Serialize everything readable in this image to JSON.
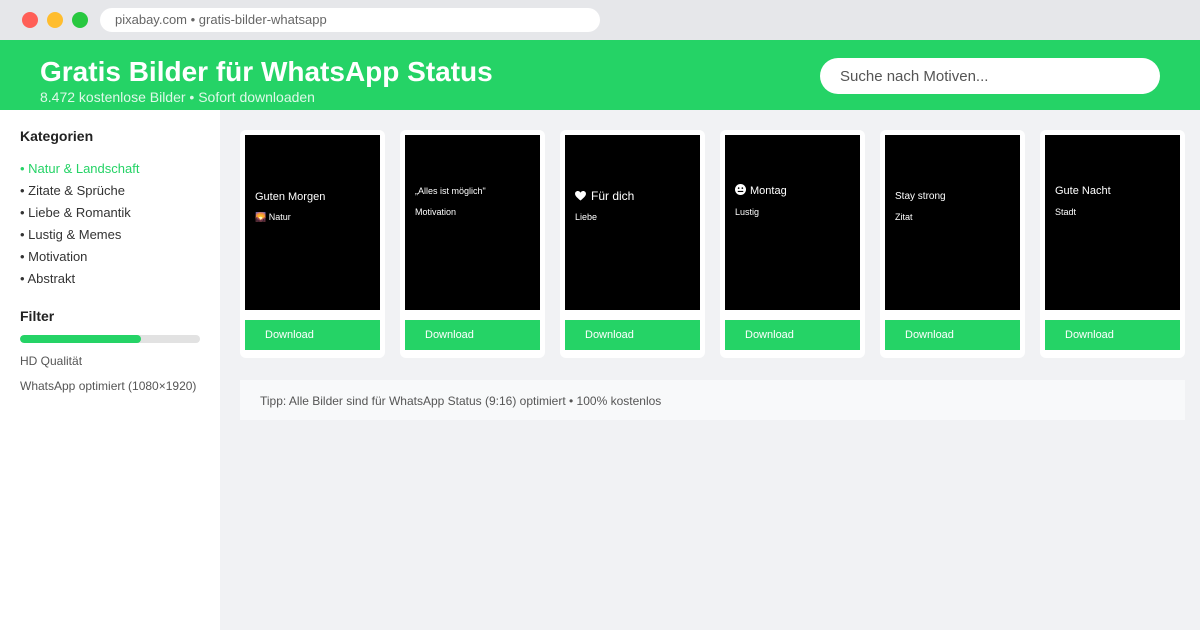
{
  "browser": {
    "url": "pixabay.com • gratis-bilder-whatsapp"
  },
  "colors": {
    "brand": "#25d366",
    "window_close": "#ff5f57",
    "window_minimize": "#ffbd2e",
    "window_maximize": "#28c840"
  },
  "header": {
    "title": "Gratis Bilder für WhatsApp Status",
    "subtitle": "8.472 kostenlose Bilder • Sofort downloaden",
    "search_placeholder": "Suche nach Motiven..."
  },
  "sidebar": {
    "categories_heading": "Kategorien",
    "categories": [
      {
        "label": "• Natur & Landschaft",
        "active": true
      },
      {
        "label": "• Zitate & Sprüche",
        "active": false
      },
      {
        "label": "• Liebe & Romantik",
        "active": false
      },
      {
        "label": "• Lustig & Memes",
        "active": false
      },
      {
        "label": "• Motivation",
        "active": false
      },
      {
        "label": "• Abstrakt",
        "active": false
      }
    ],
    "filter_heading": "Filter",
    "filter_slider_fraction": 0.67,
    "filter_options": [
      "HD Qualität",
      "WhatsApp optimiert (1080×1920)"
    ]
  },
  "cards": [
    {
      "title": "Guten Morgen",
      "tag": "🌄 Natur",
      "title_icon": "",
      "button": "Download"
    },
    {
      "title": "„Alles ist möglich\"",
      "tag": "Motivation",
      "title_icon": "",
      "button": "Download"
    },
    {
      "title": "Für dich",
      "tag": "Liebe",
      "title_icon": "heart-icon",
      "button": "Download"
    },
    {
      "title": "Montag",
      "tag": "Lustig",
      "title_icon": "emoji-icon",
      "button": "Download"
    },
    {
      "title": "Stay strong",
      "tag": "Zitat",
      "title_icon": "",
      "button": "Download"
    },
    {
      "title": "Gute Nacht",
      "tag": "Stadt",
      "title_icon": "",
      "button": "Download"
    }
  ],
  "tip": "Tipp: Alle Bilder sind für WhatsApp Status (9:16) optimiert • 100% kostenlos"
}
